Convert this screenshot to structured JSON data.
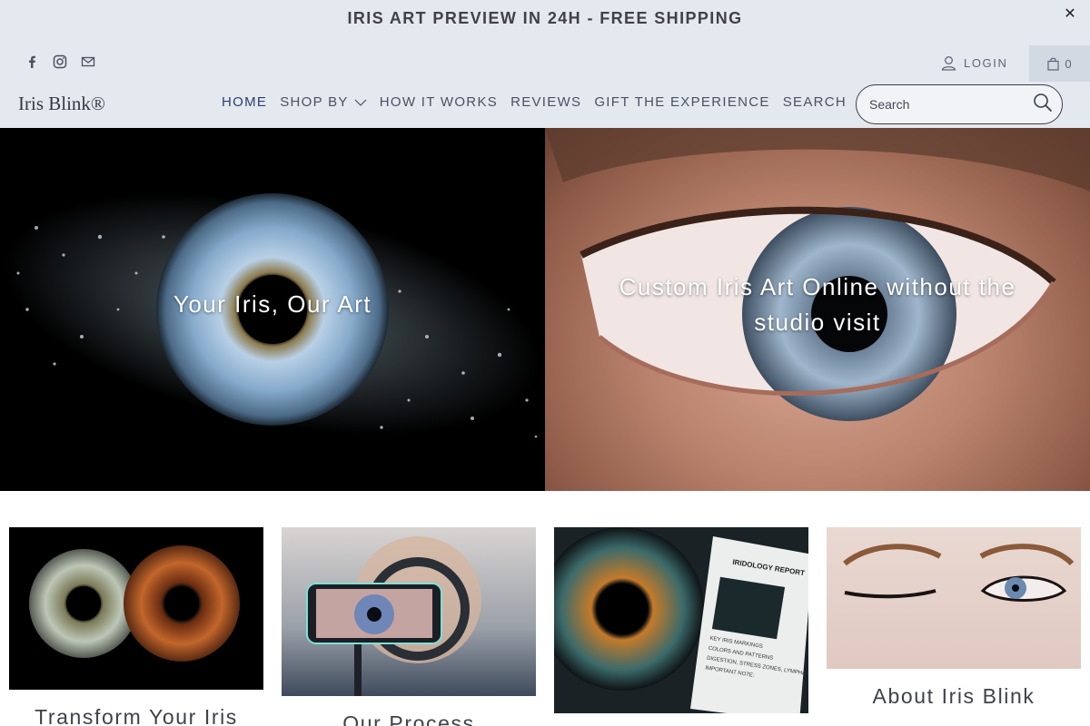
{
  "announcement": {
    "text": "IRIS ART PREVIEW IN 24H - FREE SHIPPING",
    "close_glyph": "✕"
  },
  "header": {
    "socials": [
      {
        "icon": "facebook-icon"
      },
      {
        "icon": "instagram-icon"
      },
      {
        "icon": "email-icon"
      }
    ],
    "login_label": "LOGIN",
    "cart_count": "0",
    "logo": "Iris Blink®",
    "nav": [
      {
        "label": "HOME",
        "active": true
      },
      {
        "label": "SHOP BY",
        "dropdown": true
      },
      {
        "label": "HOW IT WORKS"
      },
      {
        "label": "REVIEWS"
      },
      {
        "label": "GIFT THE EXPERIENCE"
      },
      {
        "label": "SEARCH"
      }
    ],
    "search_placeholder": "Search"
  },
  "hero": {
    "left_caption": "Your Iris, Our Art",
    "right_caption": "Custom Iris Art Online without the studio visit"
  },
  "cards": [
    {
      "title": "Transform Your Iris"
    },
    {
      "title": "Our Process"
    },
    {
      "title": ""
    },
    {
      "title": "About Iris Blink"
    }
  ],
  "report_preview": {
    "title": "IRIDOLOGY REPORT",
    "lines": [
      "KEY IRIS MARKINGS",
      "COLORS AND PATTERNS",
      "DIGESTION, STRESS ZONES, LYMPHATIC SYS",
      "IMPORTANT NOTE:"
    ]
  },
  "colors": {
    "header_bg": "#e4e8ef",
    "text": "#3f4249",
    "nav_active": "#2c4070"
  }
}
